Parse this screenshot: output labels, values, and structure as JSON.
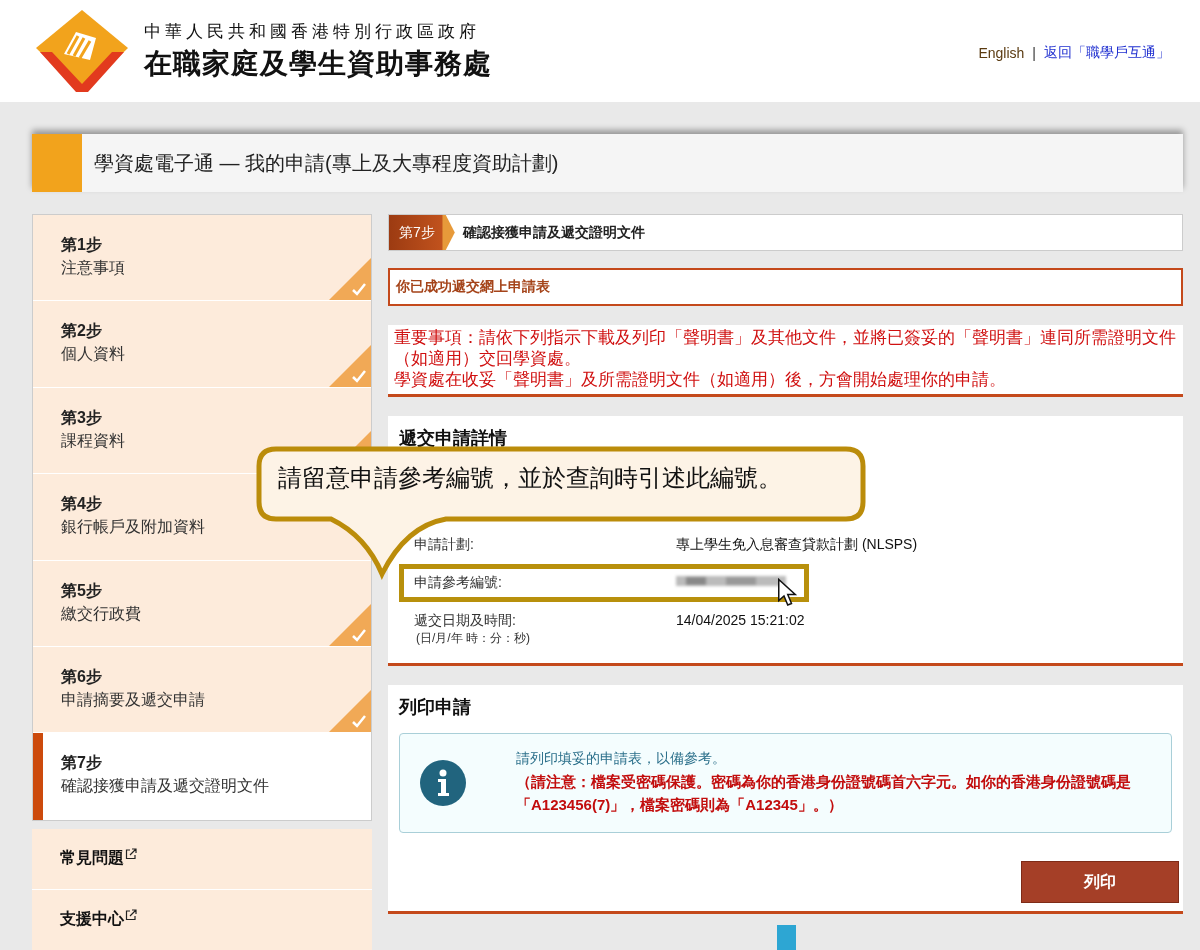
{
  "header": {
    "agency_line1": "中華人民共和國香港特別行政區政府",
    "agency_line2": "在職家庭及學生資助事務處",
    "links": [
      {
        "label": "English"
      },
      {
        "label": "返回「職學戶互通」"
      }
    ],
    "separator": "|"
  },
  "page_title": "學資處電子通 — 我的申請(專上及大專程度資助計劃)",
  "steps": [
    {
      "step": "第1步",
      "name": "注意事項",
      "completed": true,
      "selected": false
    },
    {
      "step": "第2步",
      "name": "個人資料",
      "completed": true,
      "selected": false
    },
    {
      "step": "第3步",
      "name": "課程資料",
      "completed": true,
      "selected": false
    },
    {
      "step": "第4步",
      "name": "銀行帳戶及附加資料",
      "completed": false,
      "selected": false
    },
    {
      "step": "第5步",
      "name": "繳交行政費",
      "completed": true,
      "selected": false
    },
    {
      "step": "第6步",
      "name": "申請摘要及遞交申請",
      "completed": true,
      "selected": false
    },
    {
      "step": "第7步",
      "name": "確認接獲申請及遞交證明文件",
      "completed": false,
      "selected": true
    }
  ],
  "sidebar_links": [
    {
      "label": "常見問題"
    },
    {
      "label": "支援中心"
    }
  ],
  "step_header": {
    "badge": "第7步",
    "title": "確認接獲申請及遞交證明文件"
  },
  "success_message": "你已成功遞交網上申請表",
  "notice": [
    "重要事項：請依下列指示下載及列印「聲明書」及其他文件，並將已簽妥的「聲明書」連同所需證明文件（如適用）交回學資處。",
    "學資處在收妥「聲明書」及所需證明文件（如適用）後，方會開始處理你的申請。"
  ],
  "details": {
    "title": "遞交申請詳情",
    "rows": [
      {
        "kind": "text",
        "label": "申請計劃:",
        "value": "專上學生免入息審查貸款計劃 (NLSPS)",
        "highlighted": false
      },
      {
        "kind": "redacted",
        "label": "申請參考編號:",
        "highlighted": true
      },
      {
        "kind": "text",
        "label": "遞交日期及時間:",
        "sublabel": "(日/月/年 時：分：秒)",
        "value": "14/04/2025 15:21:02",
        "highlighted": false
      }
    ]
  },
  "callout": "請留意申請參考編號，並於查詢時引述此編號。",
  "print": {
    "title": "列印申請",
    "info": "請列印填妥的申請表，以備參考。",
    "warning": "（請注意：檔案受密碼保護。密碼為你的香港身份證號碼首六字元。如你的香港身份證號碼是「A123456(7)」，檔案密碼則為「A12345」。）",
    "button": "列印"
  }
}
